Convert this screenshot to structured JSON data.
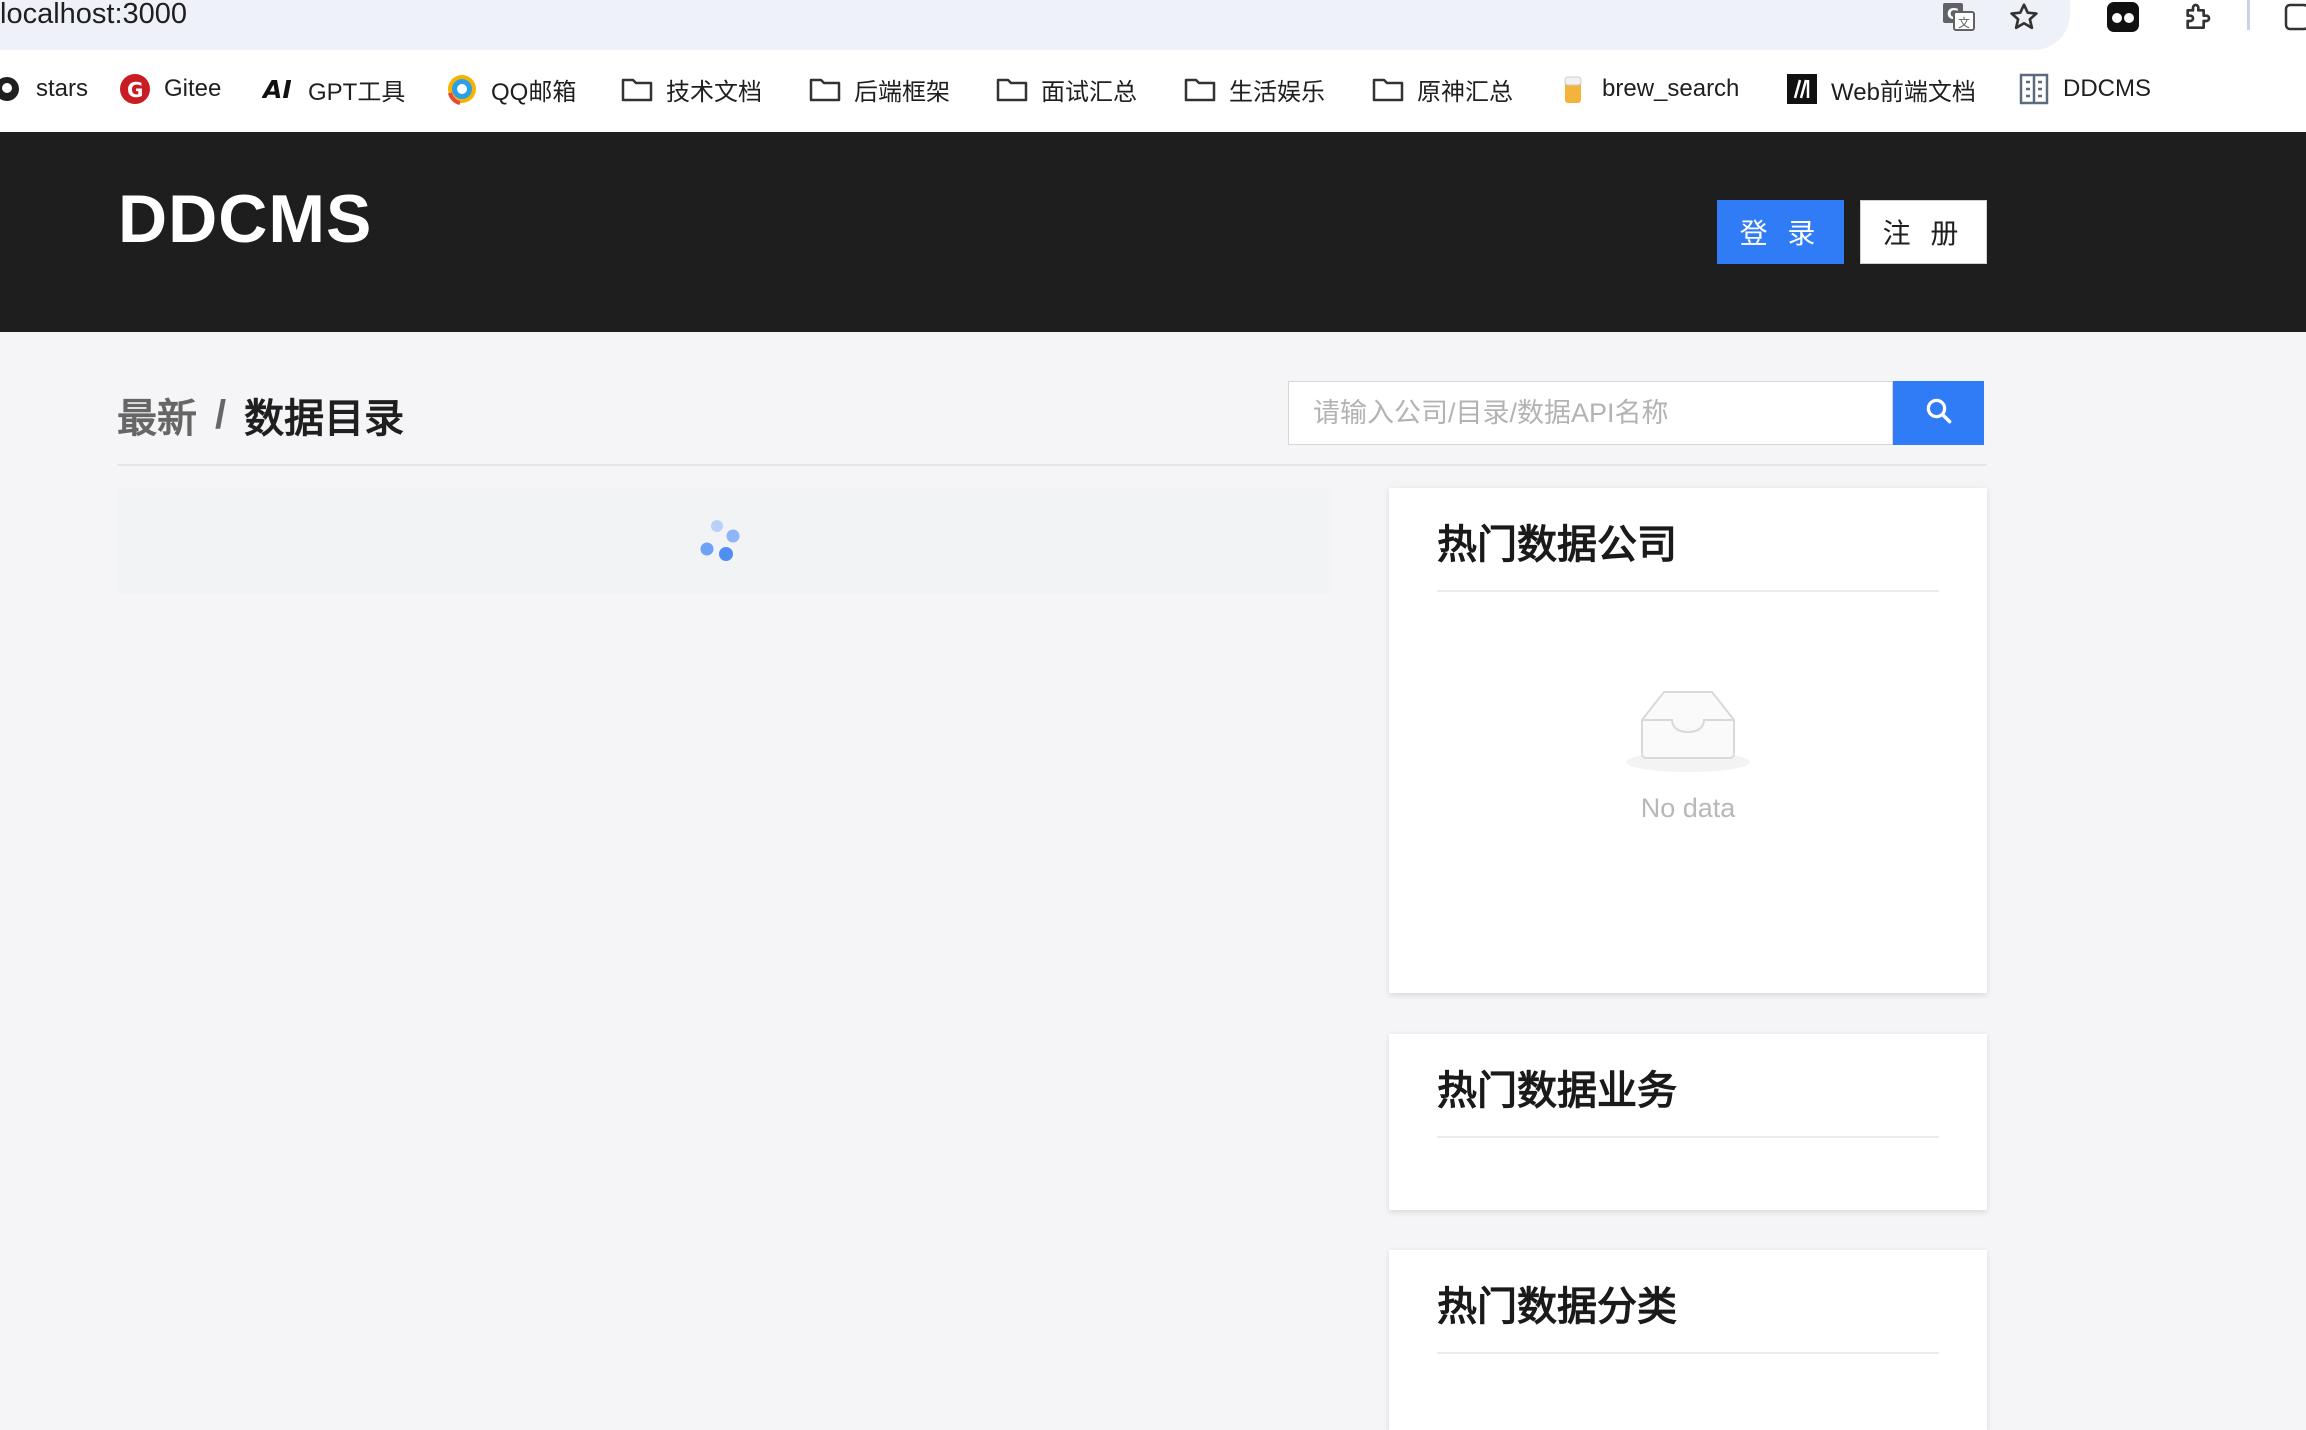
{
  "browser": {
    "url": "localhost:3000",
    "bookmarks": [
      {
        "label": "stars",
        "icon": "github-icon"
      },
      {
        "label": "Gitee",
        "icon": "gitee-icon"
      },
      {
        "label": "GPT工具",
        "icon": "ai-icon"
      },
      {
        "label": "QQ邮箱",
        "icon": "qqmail-icon"
      },
      {
        "label": "技术文档",
        "icon": "folder-icon"
      },
      {
        "label": "后端框架",
        "icon": "folder-icon"
      },
      {
        "label": "面试汇总",
        "icon": "folder-icon"
      },
      {
        "label": "生活娱乐",
        "icon": "folder-icon"
      },
      {
        "label": "原神汇总",
        "icon": "folder-icon"
      },
      {
        "label": "brew_search",
        "icon": "beer-icon"
      },
      {
        "label": "Web前端文档",
        "icon": "mdn-icon"
      },
      {
        "label": "DDCMS",
        "icon": "building-icon"
      }
    ]
  },
  "header": {
    "logo": "DDCMS",
    "login_label": "登 录",
    "register_label": "注 册"
  },
  "breadcrumb": {
    "items": [
      "最新",
      "数据目录"
    ],
    "separator": "/"
  },
  "search": {
    "placeholder": "请输入公司/目录/数据API名称",
    "value": ""
  },
  "sidebar": {
    "cards": [
      {
        "title": "热门数据公司",
        "empty_text": "No data"
      },
      {
        "title": "热门数据业务"
      },
      {
        "title": "热门数据分类"
      }
    ]
  },
  "colors": {
    "accent": "#2f7cf6",
    "header_bg": "#1e1e1e",
    "page_bg": "#f5f5f7"
  }
}
